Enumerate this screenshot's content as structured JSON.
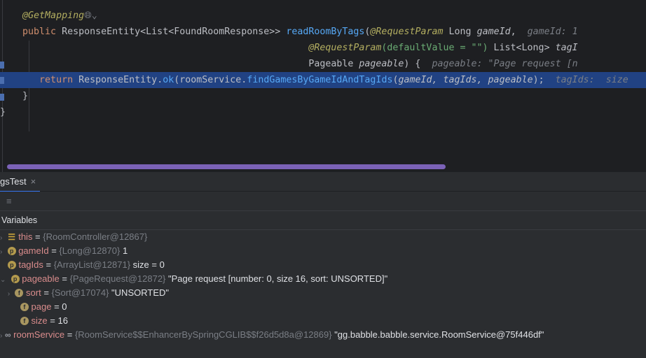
{
  "editor": {
    "line_annotation": "@GetMapping",
    "signature": {
      "public": "public",
      "ret_type": "ResponseEntity<List<FoundRoomResponse>>",
      "method": "readRoomByTags",
      "param1_ann": "@RequestParam",
      "param1_type": "Long",
      "param1_name": "gameId",
      "hint1": "gameId: 1",
      "param2_ann": "@RequestParam",
      "param2_default": "(defaultValue = \"\")",
      "param2_type": "List<Long>",
      "param2_name": "tagI",
      "param3_type": "Pageable",
      "param3_name": "pageable",
      "param3_brace": ") {",
      "hint3": "pageable: \"Page request [n"
    },
    "return_line": {
      "kw": "return",
      "cls": "ResponseEntity",
      "ok": "ok",
      "field": "roomService",
      "call": "findGamesByGameIdAndTagIds",
      "args": "gameId, tagIds, pageable",
      "end": ");",
      "hint": "tagIds:  size"
    },
    "close1": "}",
    "close2": "}"
  },
  "tab": {
    "label": "gsTest",
    "close": "×"
  },
  "variables": {
    "header": "Variables",
    "rows": [
      {
        "icon": "fields-icon",
        "name": "this",
        "ref": "{RoomController@12867}",
        "value": ""
      },
      {
        "icon": "p",
        "name": "gameId",
        "ref": "{Long@12870}",
        "value": "1"
      },
      {
        "icon": "p",
        "name": "tagIds",
        "ref": "{ArrayList@12871}",
        "value": " size = 0"
      },
      {
        "icon": "p",
        "name": "pageable",
        "ref": "{PageRequest@12872}",
        "value": "\"Page request [number: 0, size 16, sort: UNSORTED]\""
      },
      {
        "icon": "f",
        "name": "sort",
        "ref": "{Sort@17074}",
        "value": "\"UNSORTED\""
      },
      {
        "icon": "f",
        "name": "page",
        "ref": "",
        "value": "0"
      },
      {
        "icon": "f",
        "name": "size",
        "ref": "",
        "value": "16"
      },
      {
        "icon": "oo",
        "name": "roomService",
        "ref": "{RoomService$$EnhancerBySpringCGLIB$$f26d5d8a@12869}",
        "value": "\"gg.babble.babble.service.RoomService@75f446df\""
      }
    ]
  },
  "colors": {
    "highlight": "#214283",
    "tab_underline": "#3574f0",
    "scrollbar": "#8c6fd1"
  }
}
